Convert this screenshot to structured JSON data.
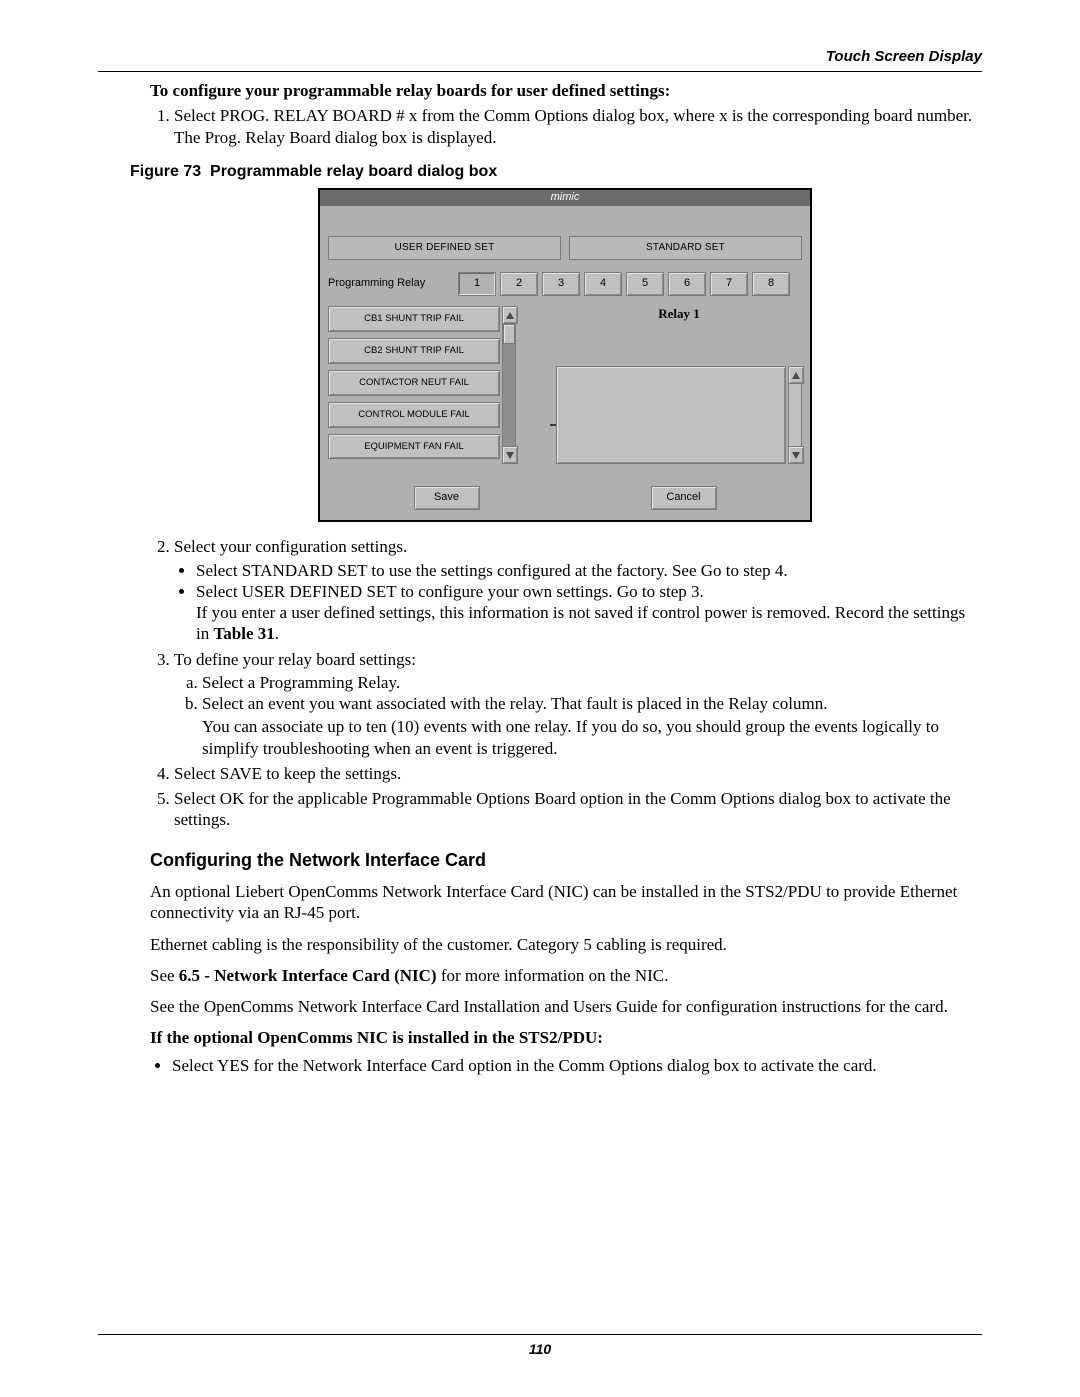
{
  "header": {
    "title": "Touch Screen Display"
  },
  "footer": {
    "page": "110"
  },
  "intro": {
    "heading": "To configure your programmable relay boards for user defined settings:",
    "step1_a": "Select PROG. RELAY BOARD # x from the Comm Options dialog box, where x is the corresponding board number.",
    "step1_b": "The Prog. Relay Board dialog box is displayed."
  },
  "figure": {
    "caption_prefix": "Figure 73",
    "caption_text": "Programmable relay board dialog box"
  },
  "mimic": {
    "title": "mimic",
    "user_defined_set": "USER DEFINED SET",
    "standard_set": "STANDARD SET",
    "programming_relay_label": "Programming Relay",
    "relay_numbers": [
      "1",
      "2",
      "3",
      "4",
      "5",
      "6",
      "7",
      "8"
    ],
    "relay_header": "Relay 1",
    "events": [
      "CB1 SHUNT TRIP FAIL",
      "CB2 SHUNT TRIP FAIL",
      "CONTACTOR NEUT FAIL",
      "CONTROL MODULE FAIL",
      "EQUIPMENT FAN FAIL"
    ],
    "save": "Save",
    "cancel": "Cancel"
  },
  "steps_after": {
    "s2": "Select your configuration settings.",
    "s2_b1": "Select STANDARD SET to use the settings configured at the factory. See Go to step 4.",
    "s2_b2": "Select USER DEFINED SET to configure your own settings. Go to step 3.",
    "s2_b2_note_a": "If you enter a user defined settings, this information is not saved if control power is removed. Record the settings in ",
    "s2_b2_note_b": "Table 31",
    "s2_b2_note_c": ".",
    "s3": "To define your relay board settings:",
    "s3_a": "Select a Programming Relay.",
    "s3_b": "Select an event you want associated with the relay. That fault is placed in the Relay column.",
    "s3_note": "You can associate up to ten (10) events with one relay. If you do so, you should group the events logically to simplify troubleshooting when an event is triggered.",
    "s4": "Select SAVE to keep the settings.",
    "s5": "Select OK for the applicable Programmable Options Board option in the Comm Options dialog box to activate the settings."
  },
  "nic": {
    "heading": "Configuring the Network Interface Card",
    "p1": "An optional Liebert OpenComms Network Interface Card (NIC) can be installed in the STS2/PDU to provide Ethernet connectivity via an RJ-45 port.",
    "p2": "Ethernet cabling is the responsibility of the customer. Category 5 cabling is required.",
    "p3_a": "See ",
    "p3_b": "6.5 - Network Interface Card (NIC)",
    "p3_c": " for more information on the NIC.",
    "p4": "See the OpenComms Network Interface Card Installation and Users Guide for configuration instructions for the card.",
    "sub": "If the optional OpenComms NIC is installed in the STS2/PDU:",
    "bul": "Select YES for the Network Interface Card option in the Comm Options dialog box to activate the card."
  }
}
